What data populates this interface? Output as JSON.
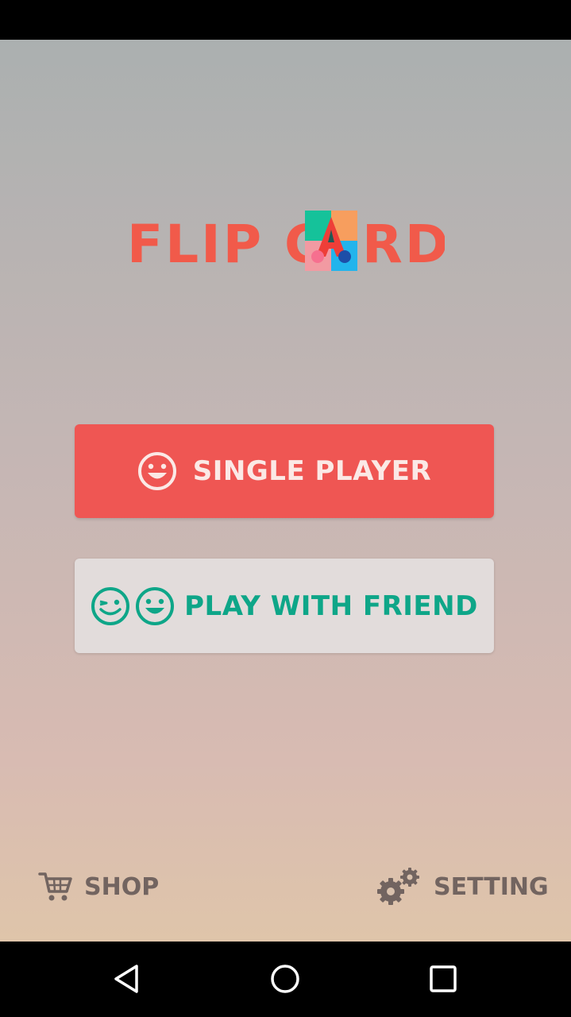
{
  "logo": {
    "text_left": "FLIP C",
    "text_right": "RD",
    "card_letter": "A",
    "colors": {
      "text": "#f15a4a",
      "tile_green": "#15c29a",
      "tile_orange": "#f79e5e",
      "tile_pink": "#f29aa2",
      "tile_blue": "#22b4ec",
      "letter_red": "#ee3e38",
      "letter_dark": "#1f5a55"
    }
  },
  "buttons": {
    "single_player": {
      "label": "SINGLE PLAYER",
      "icon": "smiley-face-icon",
      "bg": "#ef5653",
      "fg": "#fbe9e6"
    },
    "play_with_friend": {
      "label": "PLAY WITH FRIEND",
      "icons": [
        "wink-face-icon",
        "smiley-face-icon"
      ],
      "bg": "#e2dcdb",
      "fg": "#0ea688"
    }
  },
  "footer": {
    "shop": {
      "label": "SHOP",
      "icon": "cart-icon"
    },
    "setting": {
      "label": "SETTING",
      "icon": "gears-icon"
    },
    "color": "#726460"
  },
  "navbar": {
    "items": [
      "back-icon",
      "home-icon",
      "recent-apps-icon"
    ]
  }
}
